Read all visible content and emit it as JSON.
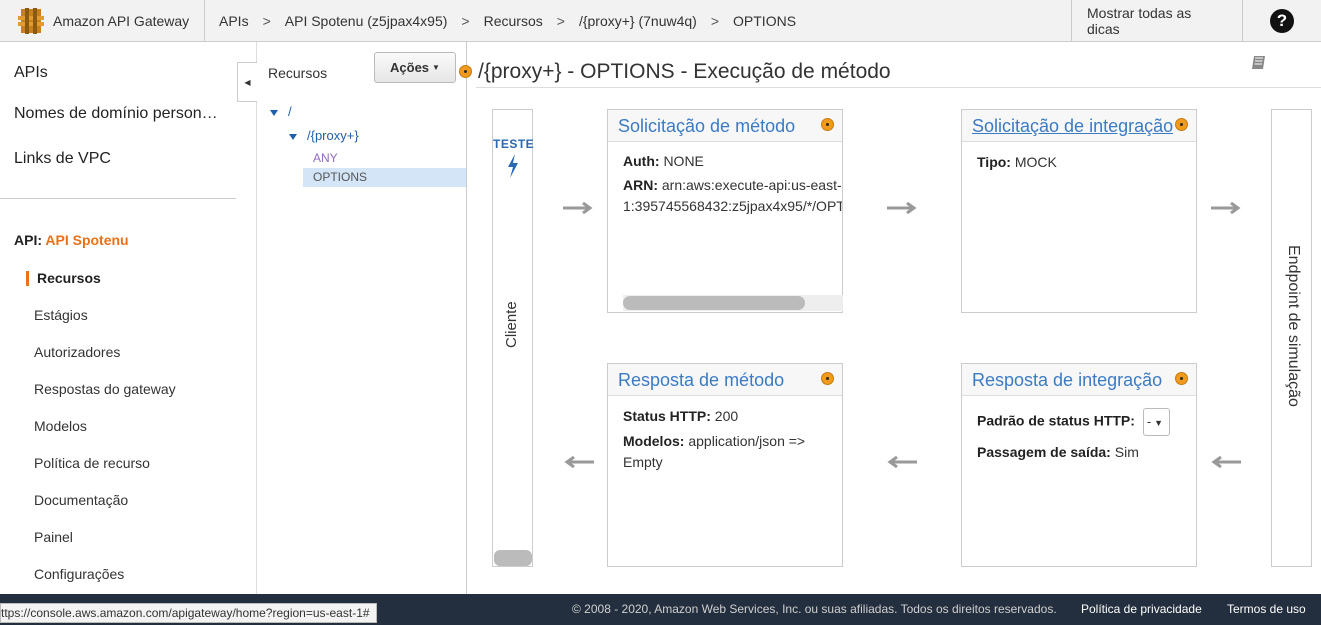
{
  "header": {
    "brand": "Amazon API Gateway",
    "breadcrumbs": [
      "APIs",
      "API Spotenu (z5jpax4x95)",
      "Recursos",
      "/{proxy+} (7nuw4q)",
      "OPTIONS"
    ],
    "separator": ">",
    "tips": "Mostrar todas as dicas",
    "help": "?"
  },
  "leftnav": {
    "top_items": [
      "APIs",
      "Nomes de domínio person…",
      "Links de VPC"
    ],
    "api_prefix": "API:",
    "api_name": "API Spotenu",
    "items": [
      "Recursos",
      "Estágios",
      "Autorizadores",
      "Respostas do gateway",
      "Modelos",
      "Política de recurso",
      "Documentação",
      "Painel",
      "Configurações"
    ]
  },
  "resources": {
    "title": "Recursos",
    "actions_label": "Ações",
    "root": "/",
    "proxy": "/{proxy+}",
    "methods": [
      "ANY",
      "OPTIONS"
    ]
  },
  "main": {
    "title": "/{proxy+} - OPTIONS - Execução de método",
    "client": {
      "test_label": "TESTE",
      "label": "Cliente"
    },
    "endpoint": "Endpoint de simulação",
    "method_request": {
      "title": "Solicitação de método",
      "auth_label": "Auth:",
      "auth_value": "NONE",
      "arn_label": "ARN:",
      "arn_line1": "arn:aws:execute-api:us-east-",
      "arn_line2": "1:395745568432:z5jpax4x95/*/OPT"
    },
    "integration_request": {
      "title": "Solicitação de integração",
      "type_label": "Tipo:",
      "type_value": "MOCK"
    },
    "method_response": {
      "title": "Resposta de método",
      "status_label": "Status HTTP:",
      "status_value": "200",
      "models_label": "Modelos:",
      "models_value": "application/json =>",
      "models_value2": "Empty"
    },
    "integration_response": {
      "title": "Resposta de integração",
      "pattern_label": "Padrão de status HTTP:",
      "pattern_value": "-",
      "passthrough_label": "Passagem de saída:",
      "passthrough_value": "Sim"
    }
  },
  "footer": {
    "copyright": "© 2008 - 2020, Amazon Web Services, Inc. ou suas afiliadas. Todos os direitos reservados.",
    "privacy": "Política de privacidade",
    "terms": "Termos de uso"
  },
  "status_url": "ttps://console.aws.amazon.com/apigateway/home?region=us-east-1#",
  "colors": {
    "accent": "#e8711a",
    "link": "#3b7bc4",
    "footer_bg": "#232f3e"
  }
}
